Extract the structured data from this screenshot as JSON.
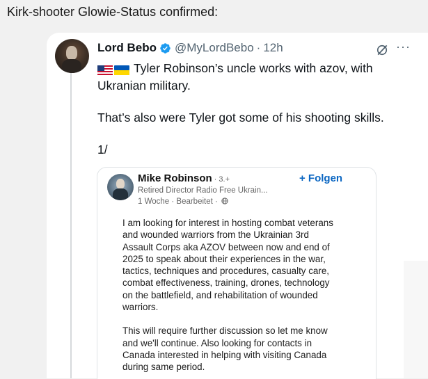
{
  "post": {
    "header": "Kirk-shooter Glowie-Status confirmed:"
  },
  "tweet": {
    "name": "Lord Bebo",
    "handle": "@MyLordBebo",
    "separator": "·",
    "time": "12h",
    "more": "···",
    "text_line1": "Tyler Robinson’s uncle works with azov, with Ukranian military.",
    "text_line2": "That’s also were Tyler got some of his shooting skills.",
    "text_line3": "1/"
  },
  "embed": {
    "name": "Mike Robinson",
    "degree": "· 3.+",
    "follow": "+ Folgen",
    "title": "Retired Director Radio Free Ukrain...",
    "time": "1 Woche · Bearbeitet ·",
    "para1_lines": [
      "I am looking for interest in hosting combat veterans",
      "and wounded warriors from the  Ukrainian 3rd",
      "Assault Corps aka AZOV between now and end of",
      "2025 to speak about their experiences in the war,",
      "tactics, techniques and procedures, casualty care,",
      "combat effectiveness, training, drones, technology",
      "on the battlefield, and rehabilitation of wounded",
      "warriors."
    ],
    "para2_lines": [
      "This will require further discussion so let me know",
      "and we'll continue. Also looking for contacts in",
      "Canada interested in helping with visiting Canada",
      "during same period."
    ]
  },
  "icons": {
    "verified": "verified-badge-icon",
    "grok": "grok-icon",
    "more": "more-options-icon",
    "globe": "globe-icon",
    "flag_us": "us-flag-icon",
    "flag_ua": "ukraine-flag-icon"
  },
  "colors": {
    "verified_blue": "#1d9bf0",
    "handle_gray": "#536471",
    "linkedin_blue": "#0a66c2",
    "background": "#f1f1f1"
  }
}
